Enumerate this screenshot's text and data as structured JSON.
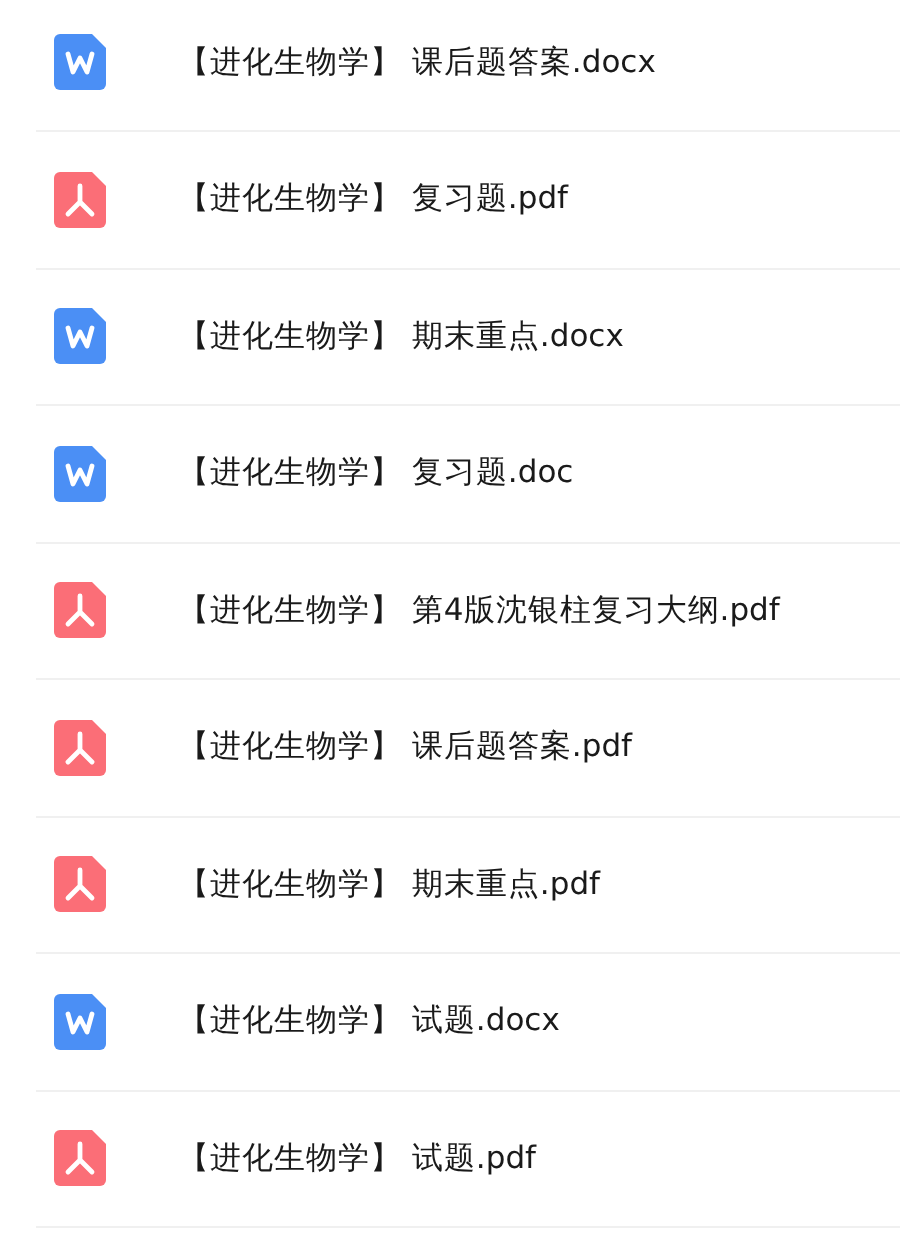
{
  "files": [
    {
      "kind": "word",
      "name": "【进化生物学】 课后题答案.docx"
    },
    {
      "kind": "pdf",
      "name": "【进化生物学】 复习题.pdf"
    },
    {
      "kind": "word",
      "name": "【进化生物学】 期末重点.docx"
    },
    {
      "kind": "word",
      "name": "【进化生物学】 复习题.doc"
    },
    {
      "kind": "pdf",
      "name": "【进化生物学】 第4版沈银柱复习大纲.pdf"
    },
    {
      "kind": "pdf",
      "name": "【进化生物学】 课后题答案.pdf"
    },
    {
      "kind": "pdf",
      "name": "【进化生物学】 期末重点.pdf"
    },
    {
      "kind": "word",
      "name": "【进化生物学】 试题.docx"
    },
    {
      "kind": "pdf",
      "name": "【进化生物学】 试题.pdf"
    }
  ]
}
